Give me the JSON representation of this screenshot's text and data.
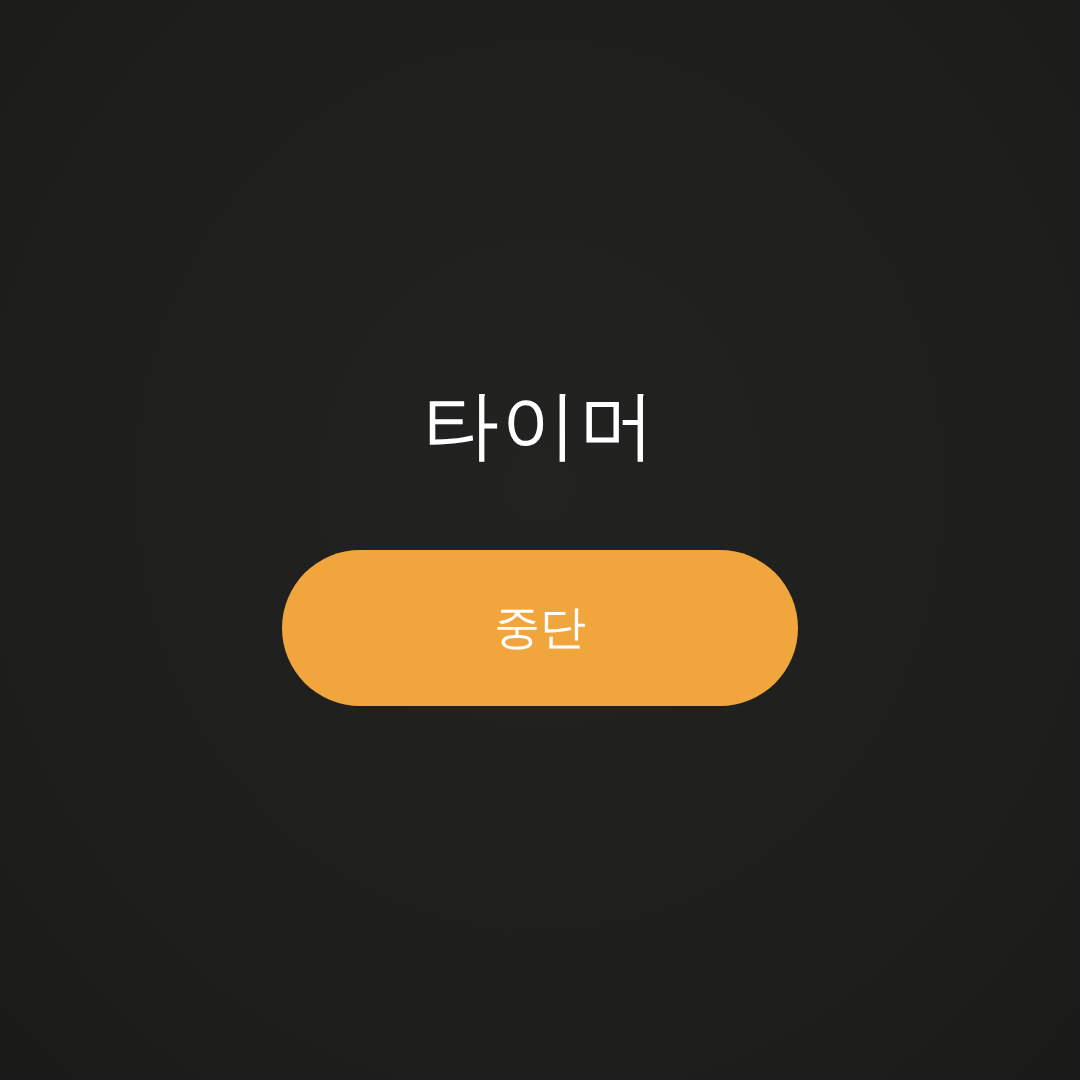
{
  "title": "타이머",
  "button": {
    "label": "중단"
  }
}
